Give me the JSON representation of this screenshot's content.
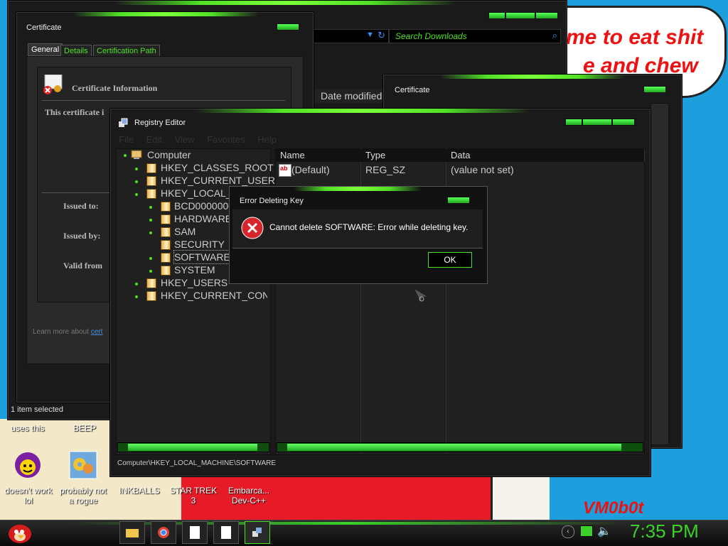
{
  "wallpaper": {
    "line1": "me to eat shit",
    "line2": "e and chew",
    "tag": "VM0b0t"
  },
  "explorer": {
    "search_placeholder": "Search Downloads",
    "column_date": "Date modified",
    "status": "1 item selected"
  },
  "certificate_main": {
    "title": "Certificate",
    "tabs": [
      "General",
      "Details",
      "Certification Path"
    ],
    "info_title": "Certificate Information",
    "purpose_text": "This certificate i",
    "issued_to": "Issued to:",
    "issued_by": "Issued by:",
    "valid_from": "Valid from",
    "learn_more": "Learn more about",
    "learn_more_link": "cert"
  },
  "certificate_second": {
    "title": "Certificate"
  },
  "registry": {
    "title": "Registry Editor",
    "menu": [
      "File",
      "Edit",
      "View",
      "Favorites",
      "Help"
    ],
    "tree": {
      "root": "Computer",
      "items": [
        "HKEY_CLASSES_ROOT",
        "HKEY_CURRENT_USER",
        "HKEY_LOCAL_"
      ],
      "sub": [
        "BCD0000000",
        "HARDWARE",
        "SAM",
        "SECURITY",
        "SOFTWARE",
        "SYSTEM"
      ],
      "items2": [
        "HKEY_USERS",
        "HKEY_CURRENT_CONFI"
      ]
    },
    "columns": [
      "Name",
      "Type",
      "Data"
    ],
    "rows": [
      {
        "name": "(Default)",
        "type": "REG_SZ",
        "data": "(value not set)"
      }
    ],
    "statusbar": "Computer\\HKEY_LOCAL_MACHINE\\SOFTWARE"
  },
  "error_dialog": {
    "title": "Error Deleting Key",
    "message": "Cannot delete SOFTWARE: Error while deleting key.",
    "ok_label": "OK"
  },
  "desktop": {
    "top_labels": [
      "uses this",
      "BEEP"
    ],
    "icons": [
      {
        "label": "doesn't work lol",
        "icon": "yahoo-messenger-icon"
      },
      {
        "label": "probably not a rogue",
        "icon": "gears-icon"
      },
      {
        "label": "INKBALLS",
        "icon": ""
      },
      {
        "label": "STAR TREK 3",
        "icon": ""
      },
      {
        "label": "Embarca... Dev-C++",
        "icon": ""
      }
    ]
  },
  "taskbar": {
    "clock": "7:35 PM",
    "items": [
      "folder-icon",
      "chrome-icon",
      "document-icon",
      "document-icon",
      "registry-icon"
    ]
  },
  "colors": {
    "accent": "#4fe026",
    "desktop": "#1c9fdc"
  }
}
